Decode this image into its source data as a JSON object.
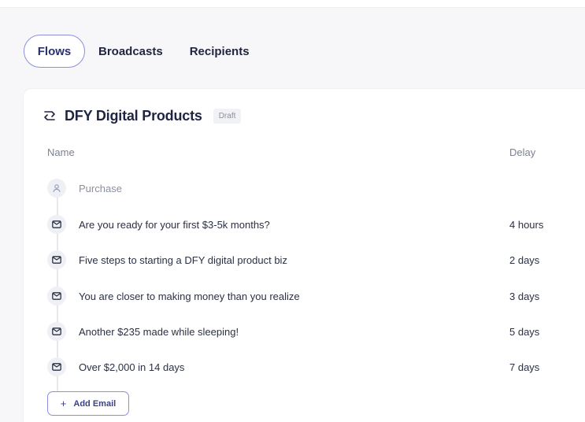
{
  "tabs": [
    {
      "label": "Flows",
      "active": true
    },
    {
      "label": "Broadcasts",
      "active": false
    },
    {
      "label": "Recipients",
      "active": false
    }
  ],
  "flow": {
    "icon": "flow-icon",
    "title": "DFY Digital Products",
    "status": "Draft"
  },
  "columns": {
    "name": "Name",
    "delay": "Delay"
  },
  "trigger": {
    "icon": "user-icon",
    "label": "Purchase"
  },
  "emails": [
    {
      "icon": "mail-icon",
      "subject": "Are you ready for your first $3-5k months?",
      "delay": "4 hours"
    },
    {
      "icon": "mail-icon",
      "subject": "Five steps to starting a DFY digital product biz",
      "delay": "2 days"
    },
    {
      "icon": "mail-icon",
      "subject": "You are closer to making money than you realize",
      "delay": "3 days"
    },
    {
      "icon": "mail-icon",
      "subject": "Another $235 made while sleeping!",
      "delay": "5 days"
    },
    {
      "icon": "mail-icon",
      "subject": "Over $2,000 in 14 days",
      "delay": "7 days"
    }
  ],
  "add_email": {
    "label": "Add Email",
    "icon": "plus-icon"
  },
  "colors": {
    "accent": "#8a90dc",
    "text": "#1f2540",
    "muted": "#8b90a0"
  }
}
